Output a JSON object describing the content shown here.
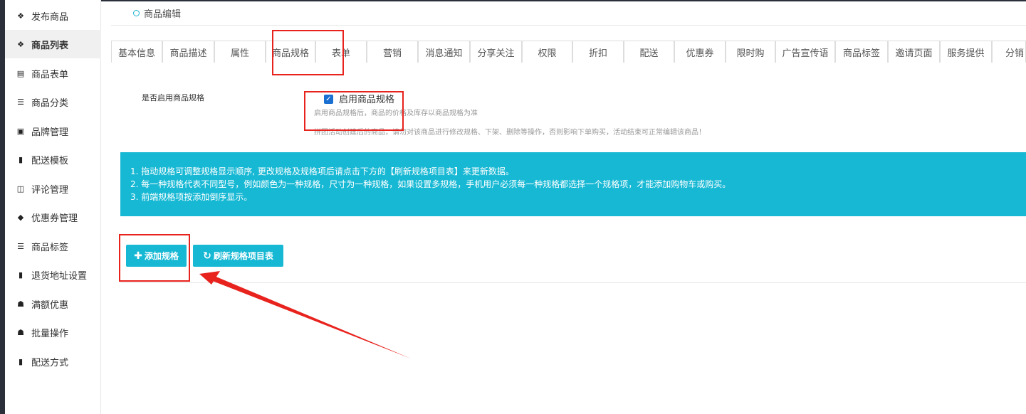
{
  "sidebar": {
    "items": [
      {
        "label": "发布商品",
        "icon": "cubes-icon"
      },
      {
        "label": "商品列表",
        "icon": "cubes-icon"
      },
      {
        "label": "商品表单",
        "icon": "file-icon"
      },
      {
        "label": "商品分类",
        "icon": "sitemap-icon"
      },
      {
        "label": "品牌管理",
        "icon": "briefcase-icon"
      },
      {
        "label": "配送模板",
        "icon": "truck-icon"
      },
      {
        "label": "评论管理",
        "icon": "columns-icon"
      },
      {
        "label": "优惠券管理",
        "icon": "tags-icon"
      },
      {
        "label": "商品标签",
        "icon": "sitemap-icon"
      },
      {
        "label": "退货地址设置",
        "icon": "truck-icon"
      },
      {
        "label": "满额优惠",
        "icon": "gift-icon"
      },
      {
        "label": "批量操作",
        "icon": "gift-icon"
      },
      {
        "label": "配送方式",
        "icon": "truck-icon"
      }
    ]
  },
  "panel": {
    "title": "商品编辑"
  },
  "tabs": [
    "基本信息",
    "商品描述",
    "属性",
    "商品规格",
    "表单",
    "营销",
    "消息通知",
    "分享关注",
    "权限",
    "折扣",
    "配送",
    "优惠券",
    "限时购",
    "广告宣传语",
    "商品标签",
    "邀请页面",
    "服务提供",
    "分销"
  ],
  "spec": {
    "label": "是否启用商品规格",
    "checkbox_label": "启用商品规格",
    "checked": true,
    "help1": "启用商品规格后，商品的价格及库存以商品规格为准",
    "help2": "拼团活动创建后的商品，请勿对该商品进行修改规格、下架、删除等操作，否则影响下单购买，活动结束可正常编辑该商品！"
  },
  "info": {
    "line1": "1. 拖动规格可调整规格显示顺序, 更改规格及规格项后请点击下方的【刷新规格项目表】来更新数据。",
    "line2": "2. 每一种规格代表不同型号，例如颜色为一种规格，尺寸为一种规格，如果设置多规格，手机用户必须每一种规格都选择一个规格项，才能添加购物车或购买。",
    "line3": "3. 前端规格项按添加倒序显示。"
  },
  "buttons": {
    "add": "添加规格",
    "refresh": "刷新规格项目表"
  },
  "colors": {
    "accent": "#17b8d4",
    "highlight": "#e8221d",
    "sidebar_dark": "#2b2f3a"
  }
}
